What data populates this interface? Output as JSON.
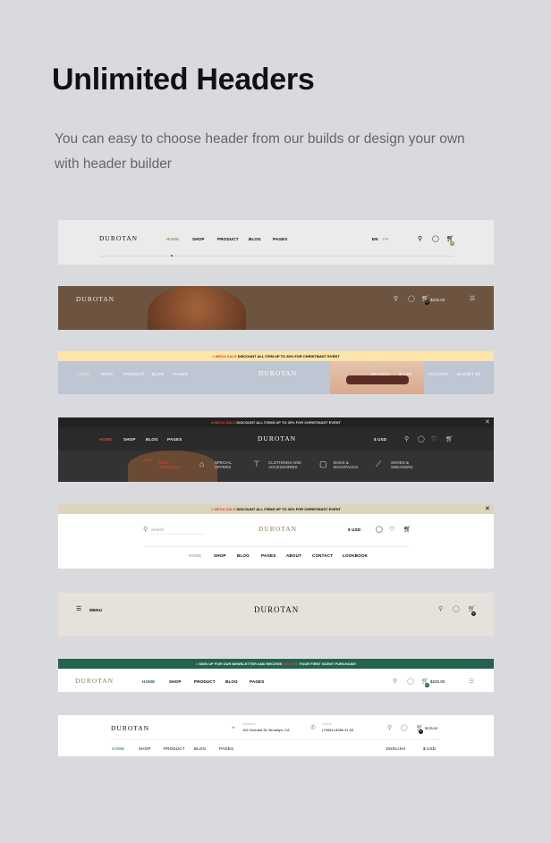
{
  "title": "Unlimited Headers",
  "subtitle": "You can easy to choose header from our builds or design your own with header builder",
  "logo": "DUROTAN",
  "h1": {
    "nav": [
      "HOME",
      "SHOP",
      "PRODUCT",
      "BLOG",
      "PAGES"
    ],
    "lang": [
      "EN",
      "FR"
    ],
    "cart_count": "0"
  },
  "h2": {
    "cart_total": "$225.00",
    "cart_count": "0"
  },
  "h3": {
    "promo_hl": "MEGA SALE",
    "promo": "DISCOUNT ALL ITEM UP TO 30% FOR CHRISTMAST EVENT",
    "nav": [
      "HOME",
      "SHOP",
      "PRODUCT",
      "BLOG",
      "PAGES"
    ],
    "right": [
      "SEARCH",
      "$ USD",
      "ACCOUNT",
      "BASKET (0)"
    ]
  },
  "h4": {
    "promo_hl": "MEGA SALE",
    "promo": "DISCOUNT ALL ITEMS UP TO 30% FOR CHRISTMAST EVENT",
    "nav": [
      "HOME",
      "SHOP",
      "BLOG",
      "PAGES"
    ],
    "currency": "$ USD",
    "categories": [
      "NEW ARRIVALS",
      "SPECIAL OFFERS",
      "CLOTHINGS AND ACCESSORIES",
      "BAGS & BACKPACKS",
      "SHOES & SNEAKERS"
    ],
    "accent": "#e1452a"
  },
  "h5": {
    "promo_hl": "MEGA SALE",
    "promo": "DISCOUNT ALL ITEMS UP TO 30% FOR CHRISTMAST EVENT",
    "search_placeholder": "Search",
    "currency": "$ USD",
    "nav": [
      "HOME",
      "SHOP",
      "BLOG",
      "PAGES",
      "ABOUT",
      "CONTACT",
      "LOOKBOOK"
    ]
  },
  "h6": {
    "menu": "MENU",
    "cart_count": "0"
  },
  "h7": {
    "promo_pre": "SIGN UP FOR OUR NEWSLETTER AND RECEIVE",
    "promo_hl": "15% OFF",
    "promo_post": "YOUR FIRST SCENT PURCHASE!",
    "nav": [
      "HOME",
      "SHOP",
      "PRODUCT",
      "BLOG",
      "PAGES"
    ],
    "cart_total": "$225.00",
    "cart_count": "0",
    "accent": "#24614f"
  },
  "h8": {
    "address_label": "ADDRESS",
    "address": "192 Orchard St, Brooklyn, CA",
    "phone_label": "PHONE",
    "phone": "(+0051) 8286 41 53",
    "cart_total": "$225.00",
    "cart_count": "0",
    "nav": [
      "HOME",
      "SHOP",
      "PRODUCT",
      "BLOG",
      "PAGES"
    ],
    "language": "ENGLISH",
    "currency": "$ USD"
  }
}
